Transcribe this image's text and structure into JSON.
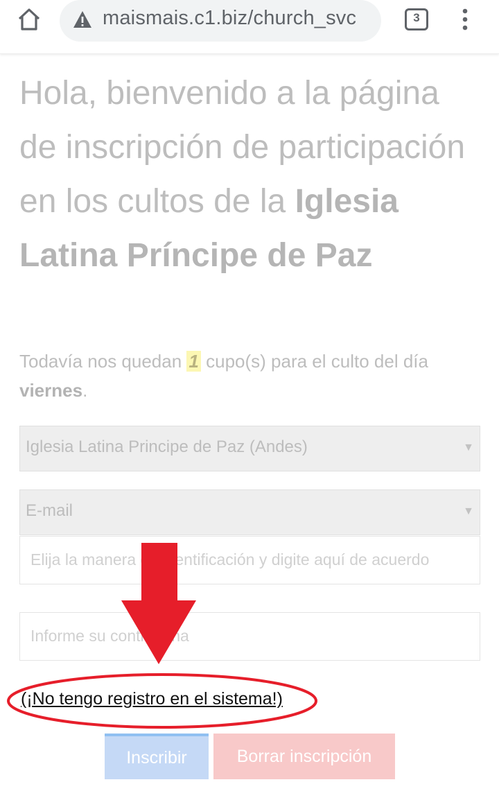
{
  "browser": {
    "url": "maismais.c1.biz/church_svc",
    "tab_count": "3"
  },
  "page": {
    "heading_normal": "Hola, bienvenido a la página de inscripción de participación en los cultos de la ",
    "heading_bold": "Iglesia Latina Príncipe de Paz",
    "sub_prefix": "Todavía nos quedan ",
    "sub_count": "1",
    "sub_middle": " cupo(s) para el culto del día ",
    "sub_day": "viernes",
    "sub_suffix": "."
  },
  "form": {
    "church_select": "Iglesia Latina Principe de Paz (Andes)",
    "id_type_select": "E-mail",
    "id_placeholder": "Elija la manera de identificación y digite aquí de acuerdo",
    "password_placeholder": "Informe su contraseña",
    "no_registration_link": "(¡No tengo registro en el sistema!)",
    "submit_label": "Inscribir",
    "delete_label": "Borrar inscripción"
  },
  "colors": {
    "annotation": "#e61e2a",
    "submit_bg": "#c5d9f6",
    "delete_bg": "#f8c9c9"
  }
}
